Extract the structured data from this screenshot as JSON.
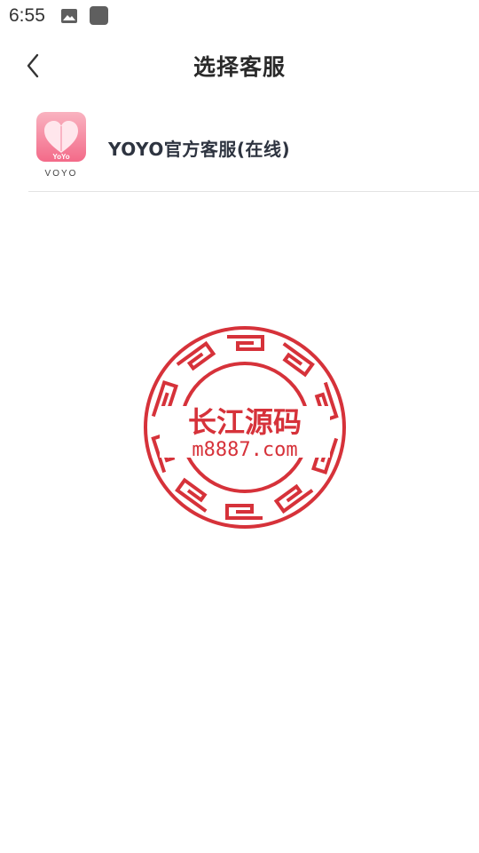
{
  "status_bar": {
    "time": "6:55",
    "icons": [
      "image-icon",
      "square-notification-icon"
    ]
  },
  "header": {
    "title": "选择客服",
    "back_icon": "chevron-left-icon"
  },
  "service_list": {
    "items": [
      {
        "name": "YOYO官方客服(在线)",
        "logo_brand": "YoYo",
        "logo_caption": "VOYO"
      }
    ]
  },
  "watermark": {
    "title": "长江源码",
    "url": "m8887.com"
  },
  "colors": {
    "background": "#ffffff",
    "title_text": "#2a2a2a",
    "divider": "#e3e3e3",
    "watermark_red": "#d6323a",
    "logo_pink": "#f47f98"
  }
}
